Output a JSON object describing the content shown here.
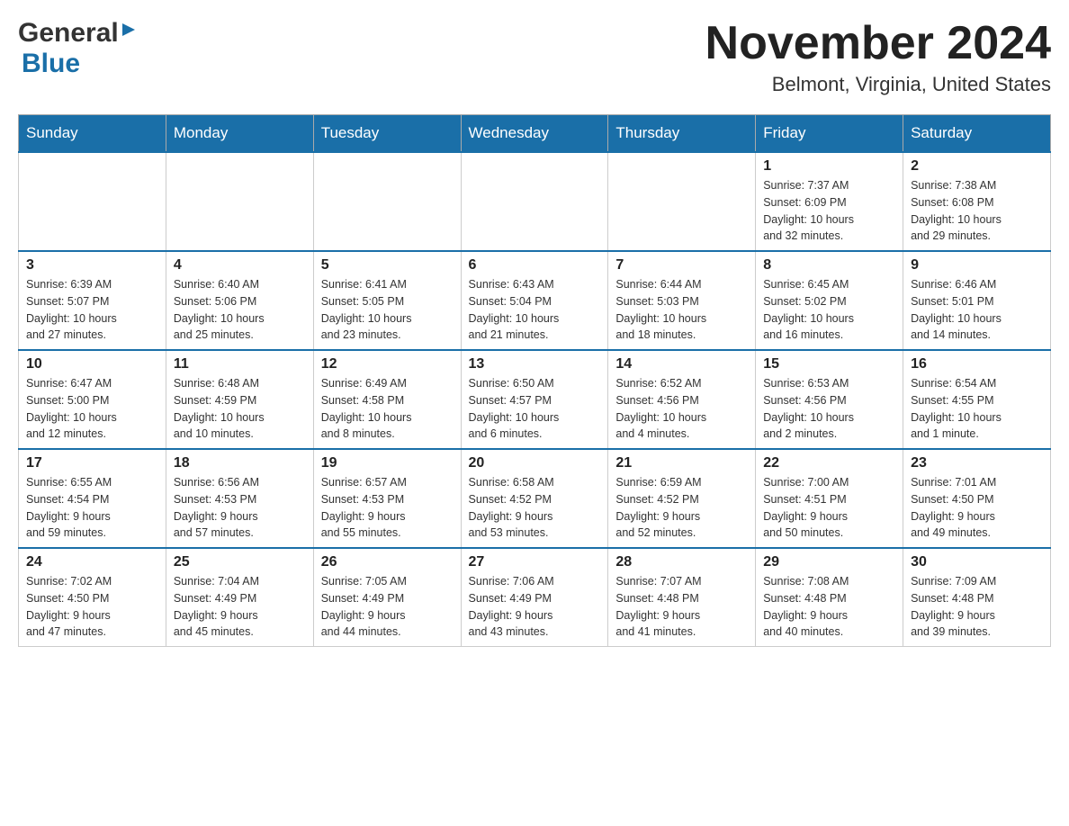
{
  "header": {
    "logo_general": "General",
    "logo_blue": "Blue",
    "month_title": "November 2024",
    "location": "Belmont, Virginia, United States"
  },
  "days_of_week": [
    "Sunday",
    "Monday",
    "Tuesday",
    "Wednesday",
    "Thursday",
    "Friday",
    "Saturday"
  ],
  "weeks": [
    {
      "days": [
        {
          "num": "",
          "info": ""
        },
        {
          "num": "",
          "info": ""
        },
        {
          "num": "",
          "info": ""
        },
        {
          "num": "",
          "info": ""
        },
        {
          "num": "",
          "info": ""
        },
        {
          "num": "1",
          "info": "Sunrise: 7:37 AM\nSunset: 6:09 PM\nDaylight: 10 hours\nand 32 minutes."
        },
        {
          "num": "2",
          "info": "Sunrise: 7:38 AM\nSunset: 6:08 PM\nDaylight: 10 hours\nand 29 minutes."
        }
      ]
    },
    {
      "days": [
        {
          "num": "3",
          "info": "Sunrise: 6:39 AM\nSunset: 5:07 PM\nDaylight: 10 hours\nand 27 minutes."
        },
        {
          "num": "4",
          "info": "Sunrise: 6:40 AM\nSunset: 5:06 PM\nDaylight: 10 hours\nand 25 minutes."
        },
        {
          "num": "5",
          "info": "Sunrise: 6:41 AM\nSunset: 5:05 PM\nDaylight: 10 hours\nand 23 minutes."
        },
        {
          "num": "6",
          "info": "Sunrise: 6:43 AM\nSunset: 5:04 PM\nDaylight: 10 hours\nand 21 minutes."
        },
        {
          "num": "7",
          "info": "Sunrise: 6:44 AM\nSunset: 5:03 PM\nDaylight: 10 hours\nand 18 minutes."
        },
        {
          "num": "8",
          "info": "Sunrise: 6:45 AM\nSunset: 5:02 PM\nDaylight: 10 hours\nand 16 minutes."
        },
        {
          "num": "9",
          "info": "Sunrise: 6:46 AM\nSunset: 5:01 PM\nDaylight: 10 hours\nand 14 minutes."
        }
      ]
    },
    {
      "days": [
        {
          "num": "10",
          "info": "Sunrise: 6:47 AM\nSunset: 5:00 PM\nDaylight: 10 hours\nand 12 minutes."
        },
        {
          "num": "11",
          "info": "Sunrise: 6:48 AM\nSunset: 4:59 PM\nDaylight: 10 hours\nand 10 minutes."
        },
        {
          "num": "12",
          "info": "Sunrise: 6:49 AM\nSunset: 4:58 PM\nDaylight: 10 hours\nand 8 minutes."
        },
        {
          "num": "13",
          "info": "Sunrise: 6:50 AM\nSunset: 4:57 PM\nDaylight: 10 hours\nand 6 minutes."
        },
        {
          "num": "14",
          "info": "Sunrise: 6:52 AM\nSunset: 4:56 PM\nDaylight: 10 hours\nand 4 minutes."
        },
        {
          "num": "15",
          "info": "Sunrise: 6:53 AM\nSunset: 4:56 PM\nDaylight: 10 hours\nand 2 minutes."
        },
        {
          "num": "16",
          "info": "Sunrise: 6:54 AM\nSunset: 4:55 PM\nDaylight: 10 hours\nand 1 minute."
        }
      ]
    },
    {
      "days": [
        {
          "num": "17",
          "info": "Sunrise: 6:55 AM\nSunset: 4:54 PM\nDaylight: 9 hours\nand 59 minutes."
        },
        {
          "num": "18",
          "info": "Sunrise: 6:56 AM\nSunset: 4:53 PM\nDaylight: 9 hours\nand 57 minutes."
        },
        {
          "num": "19",
          "info": "Sunrise: 6:57 AM\nSunset: 4:53 PM\nDaylight: 9 hours\nand 55 minutes."
        },
        {
          "num": "20",
          "info": "Sunrise: 6:58 AM\nSunset: 4:52 PM\nDaylight: 9 hours\nand 53 minutes."
        },
        {
          "num": "21",
          "info": "Sunrise: 6:59 AM\nSunset: 4:52 PM\nDaylight: 9 hours\nand 52 minutes."
        },
        {
          "num": "22",
          "info": "Sunrise: 7:00 AM\nSunset: 4:51 PM\nDaylight: 9 hours\nand 50 minutes."
        },
        {
          "num": "23",
          "info": "Sunrise: 7:01 AM\nSunset: 4:50 PM\nDaylight: 9 hours\nand 49 minutes."
        }
      ]
    },
    {
      "days": [
        {
          "num": "24",
          "info": "Sunrise: 7:02 AM\nSunset: 4:50 PM\nDaylight: 9 hours\nand 47 minutes."
        },
        {
          "num": "25",
          "info": "Sunrise: 7:04 AM\nSunset: 4:49 PM\nDaylight: 9 hours\nand 45 minutes."
        },
        {
          "num": "26",
          "info": "Sunrise: 7:05 AM\nSunset: 4:49 PM\nDaylight: 9 hours\nand 44 minutes."
        },
        {
          "num": "27",
          "info": "Sunrise: 7:06 AM\nSunset: 4:49 PM\nDaylight: 9 hours\nand 43 minutes."
        },
        {
          "num": "28",
          "info": "Sunrise: 7:07 AM\nSunset: 4:48 PM\nDaylight: 9 hours\nand 41 minutes."
        },
        {
          "num": "29",
          "info": "Sunrise: 7:08 AM\nSunset: 4:48 PM\nDaylight: 9 hours\nand 40 minutes."
        },
        {
          "num": "30",
          "info": "Sunrise: 7:09 AM\nSunset: 4:48 PM\nDaylight: 9 hours\nand 39 minutes."
        }
      ]
    }
  ]
}
